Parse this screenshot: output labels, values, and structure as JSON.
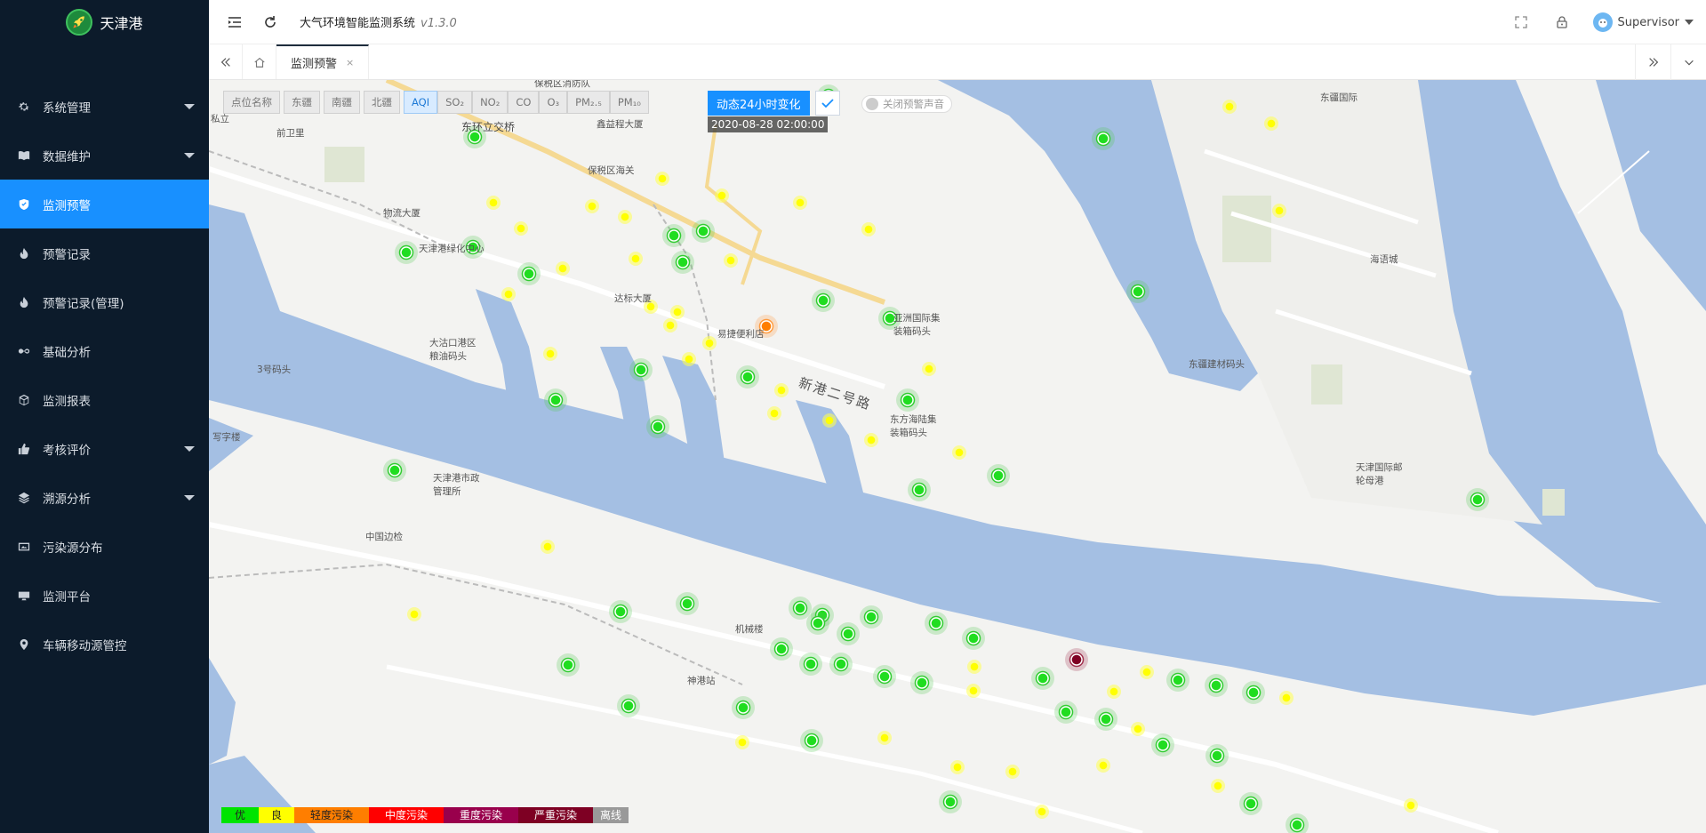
{
  "app": {
    "logo_text": "天津港",
    "system_title": "大气环境智能监测系统",
    "version": "v1.3.0",
    "user_name": "Supervisor"
  },
  "sidebar": {
    "items": [
      {
        "label": "系统管理",
        "icon": "gear-icon",
        "has_children": true
      },
      {
        "label": "数据维护",
        "icon": "book-icon",
        "has_children": true
      },
      {
        "label": "监测预警",
        "icon": "shield-check-icon",
        "active": true
      },
      {
        "label": "预警记录",
        "icon": "fire-icon"
      },
      {
        "label": "预警记录(管理)",
        "icon": "fire-icon"
      },
      {
        "label": "基础分析",
        "icon": "infinity-icon"
      },
      {
        "label": "监测报表",
        "icon": "cube-icon"
      },
      {
        "label": "考核评价",
        "icon": "thumb-up-icon",
        "has_children": true
      },
      {
        "label": "溯源分析",
        "icon": "layers-icon",
        "has_children": true
      },
      {
        "label": "污染源分布",
        "icon": "image-icon"
      },
      {
        "label": "监测平台",
        "icon": "monitor-icon"
      },
      {
        "label": "车辆移动源管控",
        "icon": "location-pin-icon"
      }
    ]
  },
  "tabs": {
    "open": [
      {
        "label": "监测预警",
        "close": "×"
      }
    ]
  },
  "toolbar": {
    "location_names": "点位名称",
    "areas": [
      "东疆",
      "南疆",
      "北疆"
    ],
    "pollutants": [
      "AQI",
      "SO₂",
      "NO₂",
      "CO",
      "O₃",
      "PM₂.₅",
      "PM₁₀"
    ],
    "selected_pollutant": "AQI",
    "dynamic_label": "动态24小时变化",
    "dynamic_time": "2020-08-28 02:00:00",
    "sound_toggle_label": "关闭预警声音"
  },
  "legend": [
    {
      "label": "优",
      "color": "#00e400"
    },
    {
      "label": "良",
      "color": "#ffff00"
    },
    {
      "label": "轻度污染",
      "color": "#ff7e00"
    },
    {
      "label": "中度污染",
      "color": "#ff0000"
    },
    {
      "label": "重度污染",
      "color": "#99004c"
    },
    {
      "label": "严重污染",
      "color": "#7e0023"
    },
    {
      "label": "离线",
      "color": "#999999"
    }
  ],
  "map_labels": {
    "poi": [
      "保税区消防队",
      "东环立交桥",
      "鑫益程大厦",
      "前卫里",
      "保税区海关",
      "物流大厦",
      "天津港绿化中心",
      "达标大厦",
      "易捷便利店",
      "大沽口港区粮油码头",
      "3号码头",
      "写字楼",
      "天津港市政管理所",
      "中国边检",
      "亚洲国际集装箱码头",
      "东方海陆集装箱码头",
      "东疆国际",
      "海语城",
      "东疆建材码头",
      "天津国际邮轮母港",
      "机械楼",
      "神港站",
      "私立"
    ],
    "road": "新港二号路"
  }
}
